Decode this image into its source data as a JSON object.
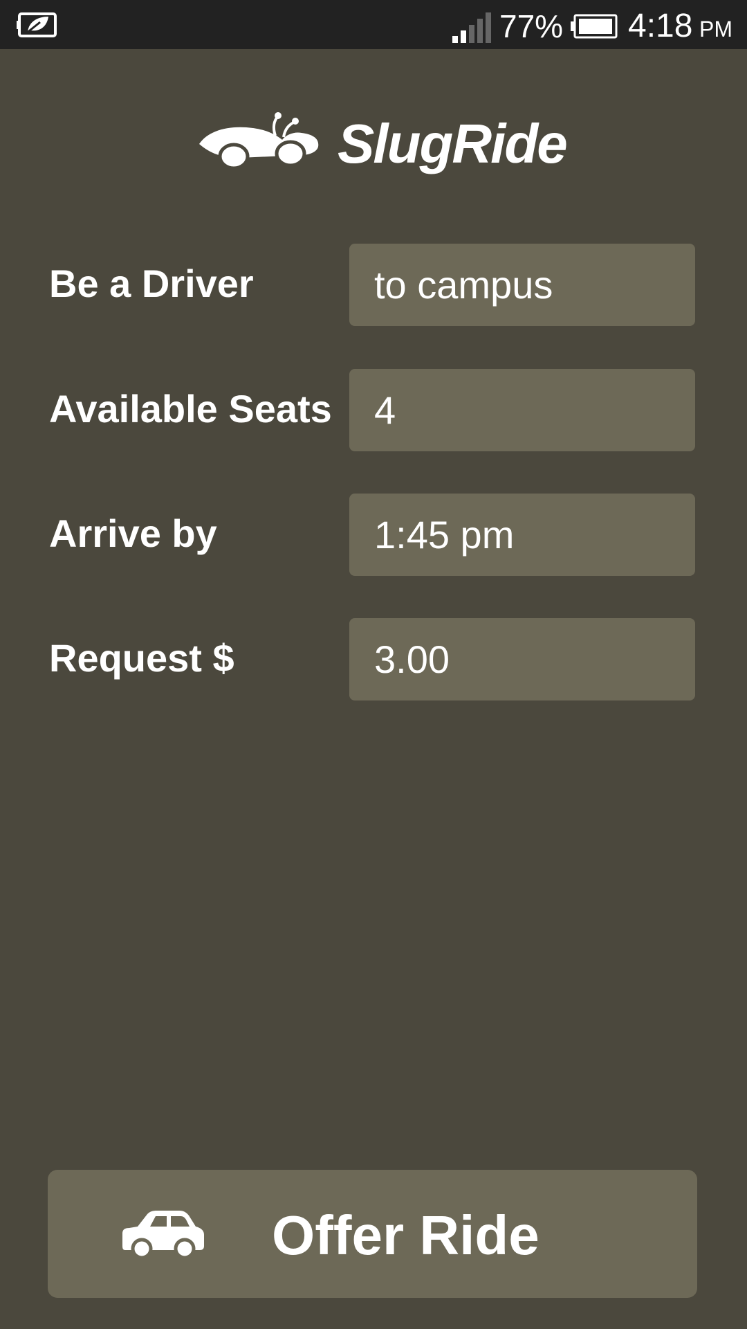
{
  "status_bar": {
    "battery_percent": "77%",
    "time": "4:18",
    "ampm": "PM",
    "icons": [
      "battery-saver-leaf-icon",
      "signal-strength-icon",
      "battery-icon"
    ]
  },
  "app": {
    "title": "SlugRide",
    "logo_icon": "slug-car-logo-icon"
  },
  "form": {
    "direction_label": "Be a Driver",
    "direction_value": "to campus",
    "seats_label": "Available Seats",
    "seats_value": "4",
    "arrive_label": "Arrive by",
    "arrive_value": "1:45 pm",
    "request_label": "Request $",
    "request_value": "3.00"
  },
  "actions": {
    "offer_label": "Offer Ride",
    "offer_icon": "car-icon"
  },
  "colors": {
    "background": "#4b483d",
    "status_bar": "#222222",
    "field_background": "#6d6957",
    "text": "#ffffff"
  }
}
